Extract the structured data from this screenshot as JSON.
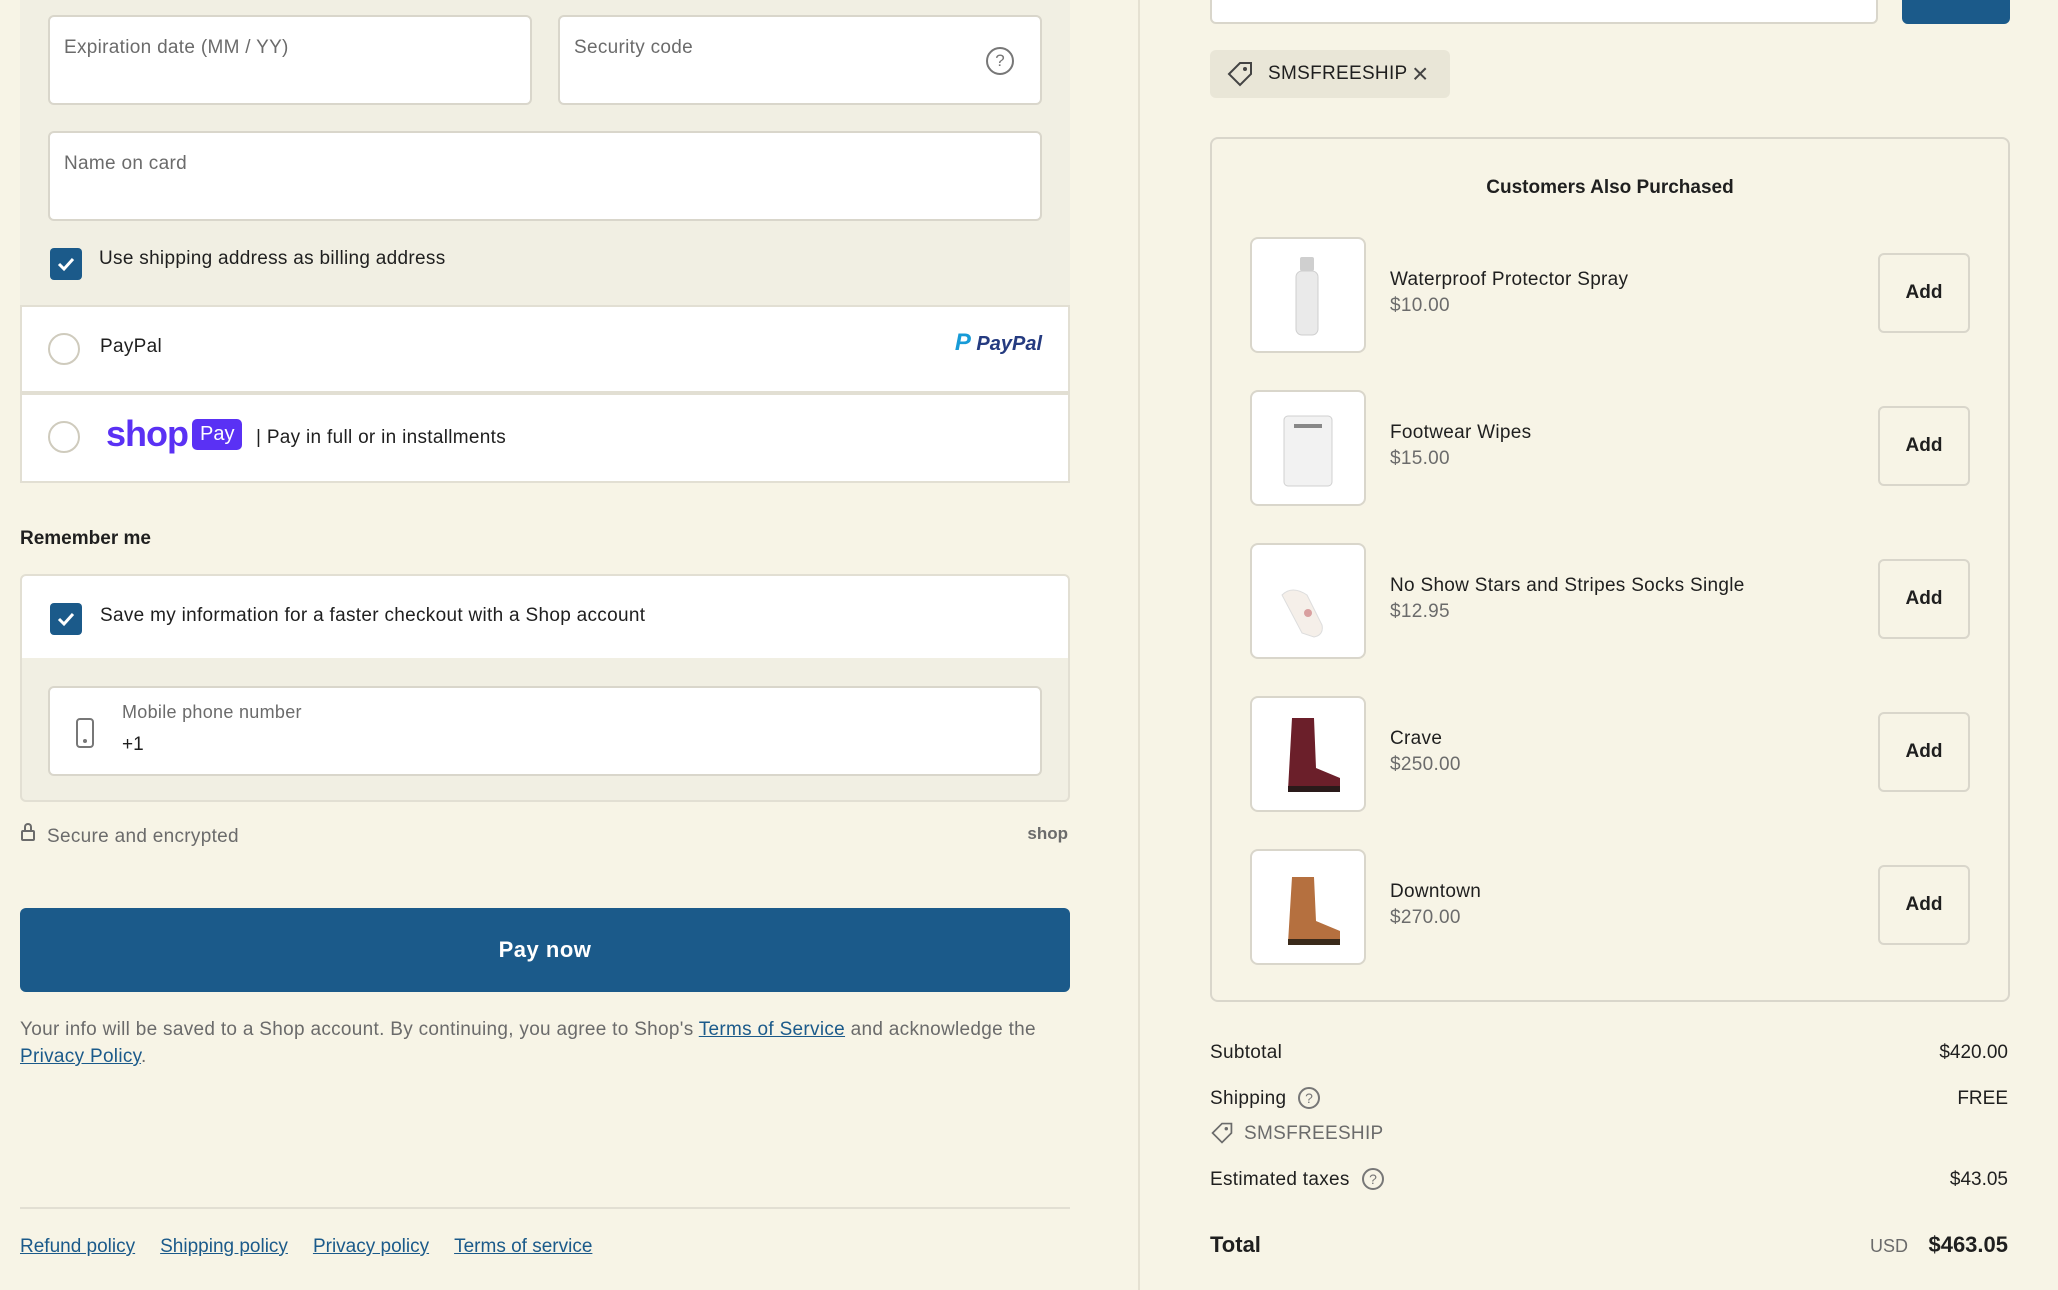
{
  "card_form": {
    "expiration_placeholder": "Expiration date (MM / YY)",
    "security_placeholder": "Security code",
    "name_placeholder": "Name on card",
    "billing_checkbox_label": "Use shipping address as billing address"
  },
  "payment_options": {
    "paypal_label": "PayPal",
    "paypal_logo_text": "PayPal",
    "shop_logo_text": "shop",
    "shop_badge_text": "Pay",
    "shop_label": "| Pay in full or in installments"
  },
  "remember_me": {
    "heading": "Remember me",
    "save_label": "Save my information for a faster checkout with a Shop account",
    "phone_label": "Mobile phone number",
    "phone_value": "+1"
  },
  "secure": {
    "text": "Secure and encrypted",
    "shop_text": "shop"
  },
  "pay_button": "Pay now",
  "consent": {
    "prefix": "Your info will be saved to a Shop account. By continuing, you agree to Shop's ",
    "terms_link": "Terms of Service",
    "middle": " and acknowledge the",
    "privacy_link": "Privacy Policy",
    "suffix": "."
  },
  "footer_links": [
    "Refund policy",
    "Shipping policy",
    "Privacy policy",
    "Terms of service"
  ],
  "discount": {
    "code": "SMSFREESHIP"
  },
  "also_purchased": {
    "heading": "Customers Also Purchased",
    "add_label": "Add",
    "products": [
      {
        "name": "Waterproof Protector Spray",
        "price": "$10.00"
      },
      {
        "name": "Footwear Wipes",
        "price": "$15.00"
      },
      {
        "name": "No Show Stars and Stripes Socks Single",
        "price": "$12.95"
      },
      {
        "name": "Crave",
        "price": "$250.00"
      },
      {
        "name": "Downtown",
        "price": "$270.00"
      }
    ]
  },
  "summary": {
    "subtotal_label": "Subtotal",
    "subtotal_value": "$420.00",
    "shipping_label": "Shipping",
    "shipping_value": "FREE",
    "shipping_code": "SMSFREESHIP",
    "taxes_label": "Estimated taxes",
    "taxes_value": "$43.05",
    "total_label": "Total",
    "total_currency": "USD",
    "total_value": "$463.05"
  },
  "colors": {
    "accent": "#1b5a8a",
    "background": "#f7f4e6",
    "shop_purple": "#5a31f4"
  }
}
